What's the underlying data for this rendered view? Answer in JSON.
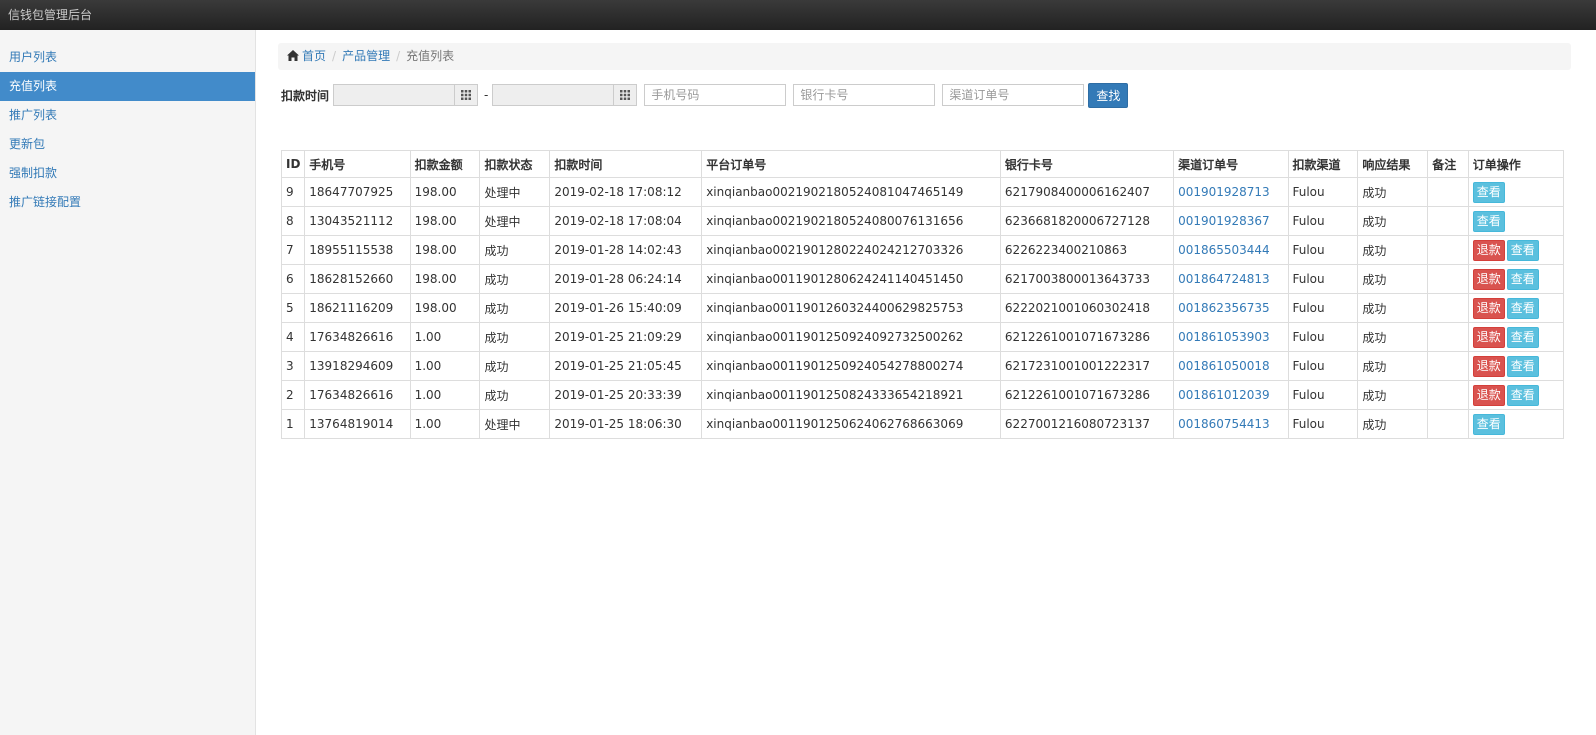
{
  "app": {
    "title": "信钱包管理后台"
  },
  "sidebar": {
    "items": [
      {
        "label": "用户列表",
        "active": false
      },
      {
        "label": "充值列表",
        "active": true
      },
      {
        "label": "推广列表",
        "active": false
      },
      {
        "label": "更新包",
        "active": false
      },
      {
        "label": "强制扣款",
        "active": false
      },
      {
        "label": "推广链接配置",
        "active": false
      }
    ]
  },
  "breadcrumb": {
    "home": "首页",
    "section": "产品管理",
    "current": "充值列表"
  },
  "search": {
    "time_label": "扣款时间",
    "date_separator": "-",
    "phone_placeholder": "手机号码",
    "card_placeholder": "银行卡号",
    "channel_order_placeholder": "渠道订单号",
    "button": "查找"
  },
  "table": {
    "headers": [
      "ID",
      "手机号",
      "扣款金额",
      "扣款状态",
      "扣款时间",
      "平台订单号",
      "银行卡号",
      "渠道订单号",
      "扣款渠道",
      "响应结果",
      "备注",
      "订单操作"
    ],
    "rows": [
      {
        "id": "9",
        "phone": "18647707925",
        "amount": "198.00",
        "status": "处理中",
        "time": "2019-02-18 17:08:12",
        "platform_order": "xinqianbao00219021805240810474651​49",
        "card": "6217908400006162407",
        "channel_order": "001901928713",
        "channel": "Fulou",
        "result": "成功",
        "note": "",
        "refund": false
      },
      {
        "id": "8",
        "phone": "13043521112",
        "amount": "198.00",
        "status": "处理中",
        "time": "2019-02-18 17:08:04",
        "platform_order": "xinqianbao0021902180524080076131656",
        "card": "6236681820006727128",
        "channel_order": "001901928367",
        "channel": "Fulou",
        "result": "成功",
        "note": "",
        "refund": false
      },
      {
        "id": "7",
        "phone": "18955115538",
        "amount": "198.00",
        "status": "成功",
        "time": "2019-01-28 14:02:43",
        "platform_order": "xinqianbao0021901280224024212703326",
        "card": "6226223400210863",
        "channel_order": "001865503444",
        "channel": "Fulou",
        "result": "成功",
        "note": "",
        "refund": true
      },
      {
        "id": "6",
        "phone": "18628152660",
        "amount": "198.00",
        "status": "成功",
        "time": "2019-01-28 06:24:14",
        "platform_order": "xinqianbao0011901280624241140451450",
        "card": "6217003800013643733",
        "channel_order": "001864724813",
        "channel": "Fulou",
        "result": "成功",
        "note": "",
        "refund": true
      },
      {
        "id": "5",
        "phone": "18621116209",
        "amount": "198.00",
        "status": "成功",
        "time": "2019-01-26 15:40:09",
        "platform_order": "xinqianbao0011901260324400629825753",
        "card": "6222021001060302418",
        "channel_order": "001862356735",
        "channel": "Fulou",
        "result": "成功",
        "note": "",
        "refund": true
      },
      {
        "id": "4",
        "phone": "17634826616",
        "amount": "1.00",
        "status": "成功",
        "time": "2019-01-25 21:09:29",
        "platform_order": "xinqianbao0011901250924092732500262",
        "card": "6212261001071673286",
        "channel_order": "001861053903",
        "channel": "Fulou",
        "result": "成功",
        "note": "",
        "refund": true
      },
      {
        "id": "3",
        "phone": "13918294609",
        "amount": "1.00",
        "status": "成功",
        "time": "2019-01-25 21:05:45",
        "platform_order": "xinqianbao0011901250924054278800274",
        "card": "6217231001001222317",
        "channel_order": "001861050018",
        "channel": "Fulou",
        "result": "成功",
        "note": "",
        "refund": true
      },
      {
        "id": "2",
        "phone": "17634826616",
        "amount": "1.00",
        "status": "成功",
        "time": "2019-01-25 20:33:39",
        "platform_order": "xinqianbao0011901250824333654218921",
        "card": "6212261001071673286",
        "channel_order": "001861012039",
        "channel": "Fulou",
        "result": "成功",
        "note": "",
        "refund": true
      },
      {
        "id": "1",
        "phone": "13764819014",
        "amount": "1.00",
        "status": "处理中",
        "time": "2019-01-25 18:06:30",
        "platform_order": "xinqianbao0011901250624062768663069",
        "card": "6227001216080723137",
        "channel_order": "001860754413",
        "channel": "Fulou",
        "result": "成功",
        "note": "",
        "refund": false
      }
    ],
    "refund_label": "退款",
    "view_label": "查看"
  },
  "colors": {
    "accent": "#428bca",
    "link": "#337ab7",
    "danger": "#d9534f",
    "info": "#5bc0de"
  },
  "icons": {
    "home": "home-icon",
    "calendar": "calendar-icon"
  }
}
